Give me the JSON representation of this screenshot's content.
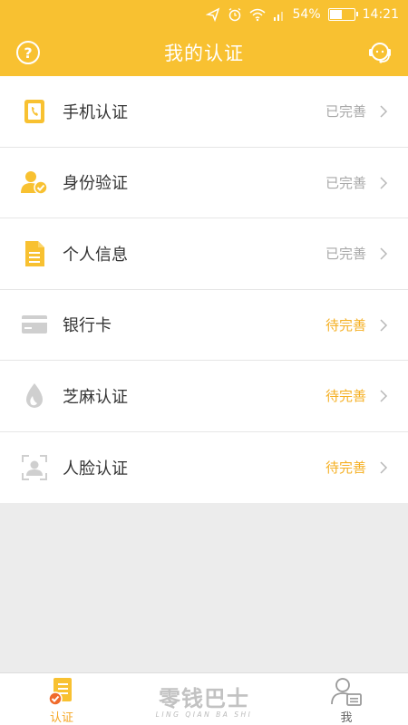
{
  "status_bar": {
    "battery": "54%",
    "battery_level": 0.54,
    "time": "14:21"
  },
  "header": {
    "title": "我的认证"
  },
  "items": [
    {
      "label": "手机认证",
      "status": "已完善",
      "state": "done",
      "icon": "phone-icon"
    },
    {
      "label": "身份验证",
      "status": "已完善",
      "state": "done",
      "icon": "id-person-icon"
    },
    {
      "label": "个人信息",
      "status": "已完善",
      "state": "done",
      "icon": "document-icon"
    },
    {
      "label": "银行卡",
      "status": "待完善",
      "state": "pending",
      "icon": "bank-card-icon"
    },
    {
      "label": "芝麻认证",
      "status": "待完善",
      "state": "pending",
      "icon": "sesame-drop-icon"
    },
    {
      "label": "人脸认证",
      "status": "待完善",
      "state": "pending",
      "icon": "face-scan-icon"
    }
  ],
  "tabbar": {
    "cert_label": "认证",
    "logo_text": "零钱巴士",
    "logo_sub": "LING QIAN BA SHI",
    "me_label": "我"
  },
  "colors": {
    "accent": "#f8c131",
    "pending": "#f5b024",
    "done": "#a8a8a8"
  }
}
